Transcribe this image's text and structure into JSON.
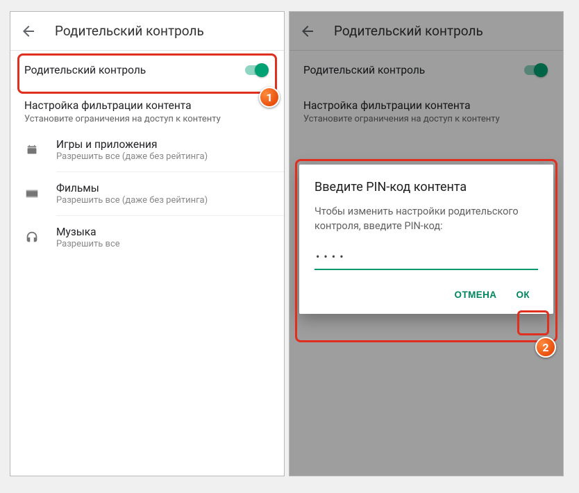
{
  "page_title": "Родительский контроль",
  "toggle": {
    "label": "Родительский контроль"
  },
  "section": {
    "heading": "Настройка фильтрации контента",
    "sub": "Установите ограничения на доступ к контенту"
  },
  "items": [
    {
      "title": "Игры и приложения",
      "sub": "Разрешить все (даже без рейтинга)"
    },
    {
      "title": "Фильмы",
      "sub": "Разрешить все (даже без рейтинга)"
    },
    {
      "title": "Музыка",
      "sub": "Разрешить все"
    }
  ],
  "dialog": {
    "title": "Введите PIN-код контента",
    "body": "Чтобы изменить настройки родительского контроля, введите PIN-код:",
    "pin_value": "••••",
    "cancel": "ОТМЕНА",
    "ok": "ОК"
  },
  "badges": {
    "one": "1",
    "two": "2"
  }
}
